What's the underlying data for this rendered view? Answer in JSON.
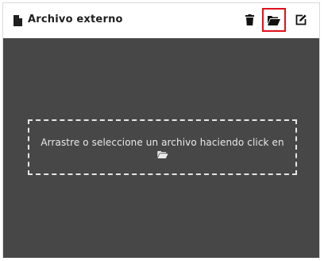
{
  "header": {
    "title": "Archivo externo",
    "actions": [
      {
        "name": "delete",
        "icon": "trash-icon"
      },
      {
        "name": "open-file",
        "icon": "folder-open-icon",
        "highlighted": true,
        "highlight_color": "#e0111b"
      },
      {
        "name": "edit",
        "icon": "edit-icon"
      }
    ]
  },
  "dropzone": {
    "text": "Arrastre o seleccione un archivo haciendo click en",
    "icon": "folder-open-icon"
  },
  "colors": {
    "body_background": "#474747",
    "dropzone_border": "#e6e6e6"
  }
}
